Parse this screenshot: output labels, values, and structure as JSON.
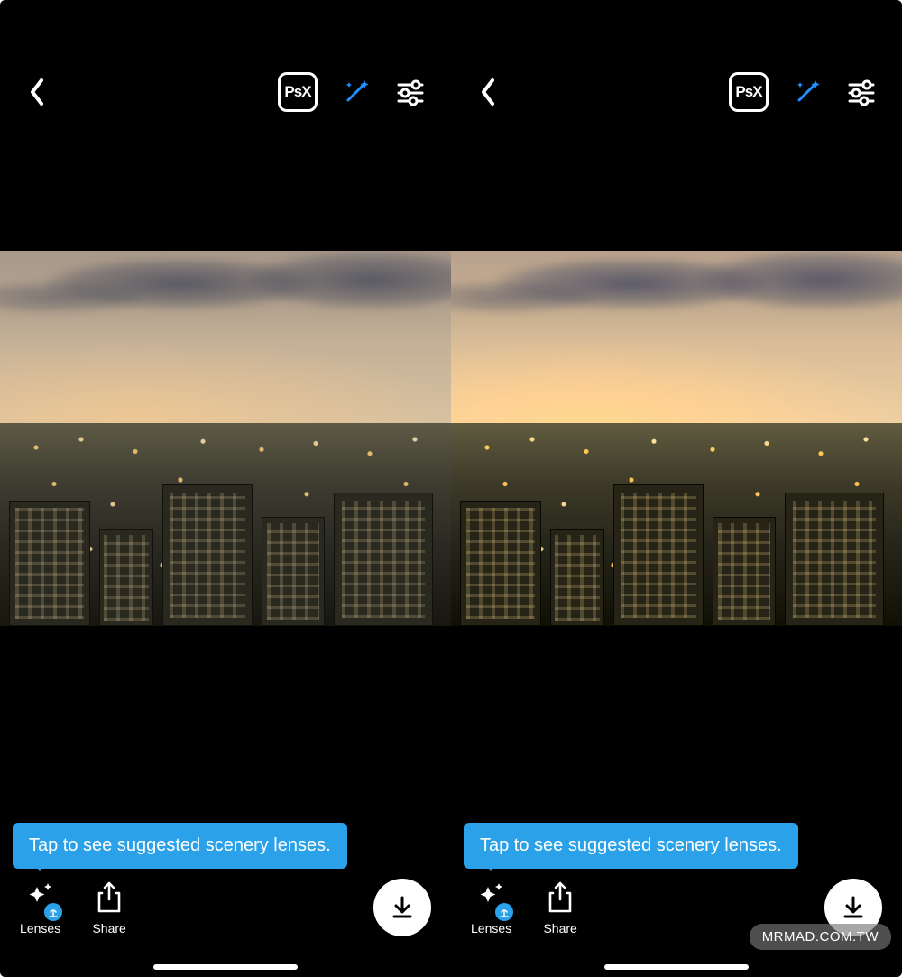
{
  "panels": {
    "left": {
      "topbar": {
        "psx_label": "PsX"
      },
      "tooltip": "Tap to see suggested scenery lenses.",
      "bottom": {
        "lenses_label": "Lenses",
        "share_label": "Share"
      }
    },
    "right": {
      "topbar": {
        "psx_label": "PsX"
      },
      "tooltip": "Tap to see suggested scenery lenses.",
      "bottom": {
        "lenses_label": "Lenses",
        "share_label": "Share"
      }
    }
  },
  "watermark": "MRMAD.COM.TW",
  "colors": {
    "accent": "#2aa1e8",
    "wand": "#1e90ff"
  }
}
